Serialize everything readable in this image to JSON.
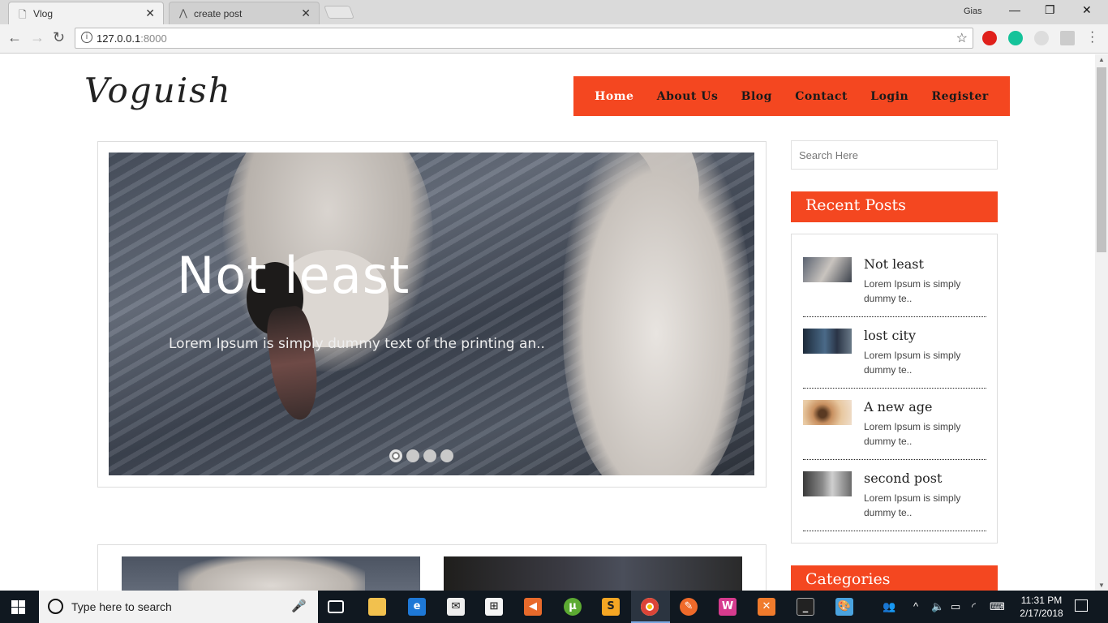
{
  "browser": {
    "tabs": [
      {
        "title": "Vlog",
        "close": "✕"
      },
      {
        "title": "create post",
        "close": "✕"
      }
    ],
    "profile_name": "Gias",
    "url_host": "127.0.0.1",
    "url_port": ":8000"
  },
  "site": {
    "logo": "Voguish",
    "nav": [
      "Home",
      "About Us",
      "Blog",
      "Contact",
      "Login",
      "Register"
    ],
    "slider": {
      "title": "Not least",
      "text": "Lorem Ipsum is simply dummy text of the printing an..",
      "dot_count": 4,
      "active_dot": 0
    },
    "sidebar": {
      "search_placeholder": "Search Here",
      "recent_heading": "Recent Posts",
      "categories_heading": "Categories",
      "recent_posts": [
        {
          "title": "Not least",
          "excerpt": "Lorem Ipsum is simply dummy te.."
        },
        {
          "title": "lost city",
          "excerpt": "Lorem Ipsum is simply dummy te.."
        },
        {
          "title": "A new age",
          "excerpt": "Lorem Ipsum is simply dummy te.."
        },
        {
          "title": "second post",
          "excerpt": "Lorem Ipsum is simply dummy te.."
        }
      ]
    }
  },
  "taskbar": {
    "search_placeholder": "Type here to search",
    "time": "11:31 PM",
    "date": "2/17/2018"
  },
  "colors": {
    "accent": "#f44720"
  }
}
